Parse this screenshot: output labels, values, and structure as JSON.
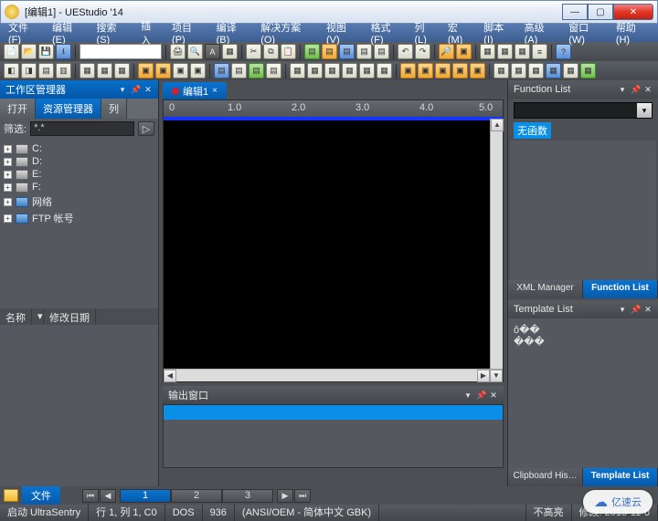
{
  "window": {
    "title": "[编辑1] - UEStudio '14"
  },
  "menu": [
    "文件(F)",
    "编辑(E)",
    "搜索(S)",
    "插入",
    "项目(P)",
    "编译(B)",
    "解决方案(O)",
    "视图(V)",
    "格式(F)",
    "列(L)",
    "宏(M)",
    "脚本(I)",
    "高级(A)",
    "窗口(W)",
    "帮助(H)"
  ],
  "left": {
    "header": "工作区管理器",
    "tabs": [
      "打开",
      "资源管理器",
      "列"
    ],
    "filter_label": "筛选:",
    "filter_value": "*.*",
    "tree": [
      {
        "icon": "drv",
        "label": "C:"
      },
      {
        "icon": "drv",
        "label": "D:"
      },
      {
        "icon": "drv",
        "label": "E:"
      },
      {
        "icon": "drv",
        "label": "F:"
      },
      {
        "icon": "net",
        "label": "网络"
      },
      {
        "icon": "net",
        "label": "FTP 帐号"
      }
    ],
    "detail_cols": [
      "名称",
      "修改日期"
    ]
  },
  "center": {
    "doc_tab": "编辑1",
    "ruler": [
      "0",
      "1.0",
      "2.0",
      "3.0",
      "4.0",
      "5.0"
    ],
    "output_title": "输出窗口"
  },
  "right": {
    "func_header": "Function List",
    "no_func": "无函数",
    "tabs1": [
      "XML Manager",
      "Function List"
    ],
    "tmpl_header": "Template List",
    "tmpl_items": [
      "ô��",
      "���"
    ],
    "tabs2": [
      "Clipboard His…",
      "Template List"
    ]
  },
  "bottom": {
    "file_tab": "文件",
    "pages": [
      "1",
      "2",
      "3"
    ]
  },
  "status": {
    "launch": "启动 UltraSentry",
    "pos": "行 1, 列 1, C0",
    "enc1": "DOS",
    "cp": "936",
    "enc2": "(ANSI/OEM - 简体中文 GBK)",
    "hilite": "不高亮",
    "mod": "修改: 2013-11-0"
  },
  "watermark": "亿速云"
}
